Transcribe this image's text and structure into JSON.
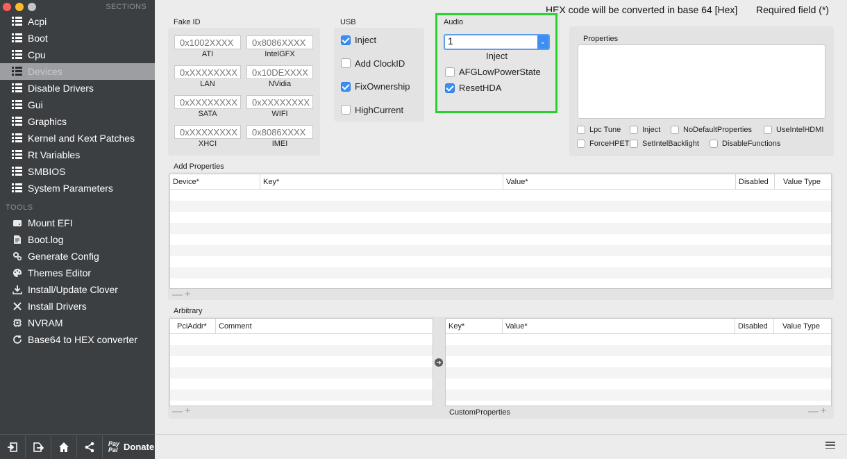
{
  "sidebar": {
    "sections_header": "SECTIONS",
    "sections": [
      {
        "label": "Acpi"
      },
      {
        "label": "Boot"
      },
      {
        "label": "Cpu"
      },
      {
        "label": "Devices",
        "selected": true
      },
      {
        "label": "Disable Drivers"
      },
      {
        "label": "Gui"
      },
      {
        "label": "Graphics"
      },
      {
        "label": "Kernel and Kext Patches"
      },
      {
        "label": "Rt Variables"
      },
      {
        "label": "SMBIOS"
      },
      {
        "label": "System Parameters"
      }
    ],
    "tools_header": "TOOLS",
    "tools": [
      {
        "label": "Mount EFI",
        "icon": "drive-icon"
      },
      {
        "label": "Boot.log",
        "icon": "document-icon"
      },
      {
        "label": "Generate Config",
        "icon": "gears-icon"
      },
      {
        "label": "Themes Editor",
        "icon": "palette-icon"
      },
      {
        "label": "Install/Update Clover",
        "icon": "download-icon"
      },
      {
        "label": "Install Drivers",
        "icon": "wrench-icon"
      },
      {
        "label": "NVRAM",
        "icon": "chip-icon"
      },
      {
        "label": "Base64 to HEX converter",
        "icon": "refresh-icon"
      }
    ],
    "bottom": {
      "paypal_line1": "Pay",
      "paypal_line2": "Pal",
      "donate_label": "Donate"
    }
  },
  "header": {
    "hex_note": "HEX code will be converted in base 64 [Hex]",
    "required_note": "Required field (*)"
  },
  "fake_id": {
    "title": "Fake ID",
    "fields": [
      {
        "placeholder": "0x1002XXXX",
        "caption": "ATI"
      },
      {
        "placeholder": "0x8086XXXX",
        "caption": "IntelGFX"
      },
      {
        "placeholder": "0xXXXXXXXX",
        "caption": "LAN"
      },
      {
        "placeholder": "0x10DEXXXX",
        "caption": "NVidia"
      },
      {
        "placeholder": "0xXXXXXXXX",
        "caption": "SATA"
      },
      {
        "placeholder": "0xXXXXXXXX",
        "caption": "WIFI"
      },
      {
        "placeholder": "0xXXXXXXXX",
        "caption": "XHCI"
      },
      {
        "placeholder": "0x8086XXXX",
        "caption": "IMEI"
      }
    ]
  },
  "usb": {
    "title": "USB",
    "options": [
      {
        "label": "Inject",
        "checked": true
      },
      {
        "label": "Add ClockID",
        "checked": false
      },
      {
        "label": "FixOwnership",
        "checked": true
      },
      {
        "label": "HighCurrent",
        "checked": false
      }
    ]
  },
  "audio": {
    "title": "Audio",
    "inject_value": "1",
    "inject_caption": "Inject",
    "options": [
      {
        "label": "AFGLowPowerState",
        "checked": false
      },
      {
        "label": "ResetHDA",
        "checked": true
      }
    ],
    "highlight_color": "#2bd12b"
  },
  "properties": {
    "title": "Properties",
    "options": [
      {
        "label": "Lpc Tune",
        "checked": false
      },
      {
        "label": "Inject",
        "checked": false
      },
      {
        "label": "NoDefaultProperties",
        "checked": false
      },
      {
        "label": "UseIntelHDMI",
        "checked": false
      },
      {
        "label": "ForceHPET",
        "checked": false
      },
      {
        "label": "SetIntelBacklight",
        "checked": false
      },
      {
        "label": "DisableFunctions",
        "checked": false
      }
    ]
  },
  "add_properties": {
    "title": "Add Properties",
    "columns": [
      "Device*",
      "Key*",
      "Value*",
      "Disabled",
      "Value Type"
    ],
    "rows": []
  },
  "arbitrary": {
    "title": "Arbitrary",
    "left_columns": [
      "PciAddr*",
      "Comment"
    ],
    "right_columns": [
      "Key*",
      "Value*",
      "Disabled",
      "Value Type"
    ],
    "custom_label": "CustomProperties"
  },
  "colors": {
    "accent": "#3b8ef3",
    "sidebar_bg": "#3c3f42",
    "selected_row": "#9c9ea1"
  }
}
